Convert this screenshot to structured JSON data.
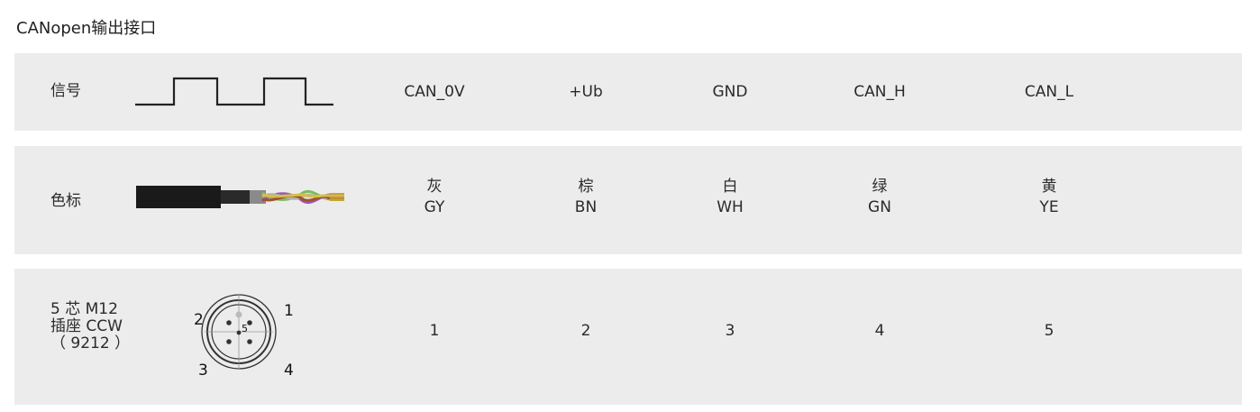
{
  "title": "CANopen输出接口",
  "rows": {
    "signal": {
      "label": "信号",
      "values": [
        "CAN_0V",
        "+Ub",
        "GND",
        "CAN_H",
        "CAN_L"
      ]
    },
    "color": {
      "label": "色标",
      "values": [
        {
          "cn": "灰",
          "code": "GY"
        },
        {
          "cn": "棕",
          "code": "BN"
        },
        {
          "cn": "白",
          "code": "WH"
        },
        {
          "cn": "绿",
          "code": "GN"
        },
        {
          "cn": "黄",
          "code": "YE"
        }
      ]
    },
    "pin": {
      "label_line1": "5 芯 M12",
      "label_line2": "插座 CCW",
      "label_line3": "（ 9212 ）",
      "values": [
        "1",
        "2",
        "3",
        "4",
        "5"
      ],
      "connector_pins": [
        "1",
        "2",
        "3",
        "4",
        "5"
      ]
    }
  },
  "colors": {
    "row_bg": "#ececec",
    "text": "#2a2a2a",
    "cable_jacket": "#1a1a1a"
  }
}
